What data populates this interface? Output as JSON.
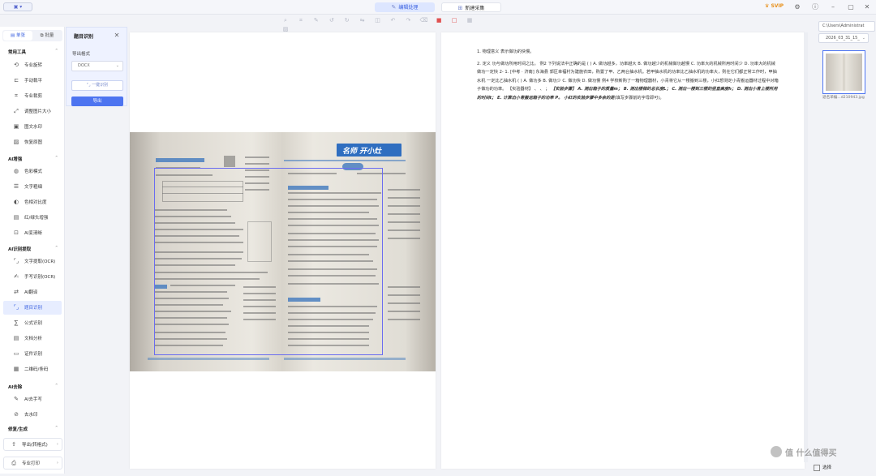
{
  "app": {
    "menu_icon": "app-menu-icon",
    "tabs": [
      {
        "label": "编辑处理",
        "icon": "edit-icon"
      },
      {
        "label": "新建采集",
        "icon": "capture-icon"
      }
    ],
    "svip": "SVIP",
    "window_icons": [
      "settings-icon",
      "help-icon",
      "minimize-icon",
      "maximize-icon",
      "close-icon"
    ]
  },
  "toolbar": {
    "tools": [
      "search-icon",
      "crop-icon",
      "pen-icon",
      "rotate-left-icon",
      "rotate-right-icon",
      "flip-icon",
      "compare-icon",
      "undo-icon",
      "redo-icon",
      "delete-icon",
      "rect-red-icon",
      "rect-outline-red-icon",
      "grid-icon",
      "image-icon"
    ]
  },
  "sidebar": {
    "tabs": [
      "单张",
      "批量"
    ],
    "sections": [
      {
        "title": "常用工具",
        "items": [
          "专业旋转",
          "手动裁平",
          "专业裁剪",
          "调整图片大小",
          "图文水印",
          "恢复原图"
        ]
      },
      {
        "title": "AI增强",
        "items": [
          "色彩模式",
          "文字粗细",
          "色相对比度",
          "红/绿头增强",
          "AI变清晰"
        ]
      },
      {
        "title": "AI识别提取",
        "items": [
          "文字提取(OCR)",
          "手写识别(OCR)",
          "AI翻译",
          "题目识别",
          "公式识别",
          "文档分析",
          "证件识别",
          "二维码/条码"
        ]
      },
      {
        "title": "AI去除",
        "items": [
          "AI去手写",
          "去水印"
        ]
      },
      {
        "title": "修复/生成",
        "items": []
      }
    ],
    "footer": [
      {
        "label": "导出(转格式)"
      },
      {
        "label": "专业打印"
      }
    ],
    "active_item": "题目识别"
  },
  "panel": {
    "title": "题目识别",
    "export_label": "导出格式",
    "format_value": "DOCX",
    "onekey_label": "一键识别",
    "export_button": "导出"
  },
  "photo": {
    "brand_text": "名师 开小灶"
  },
  "ocr": {
    "p1": "1. 物理意义 表示做功的快慢。",
    "p2a": "2. 定义 功与做功所用时间之比。 例2 下列说法中正确的是 ( ) A. 做功越多，功率越大 B. 做功越少的机械做功越慢 C. 功率大的机械所用时间少 D. 功率大的机械做功一定快 2- 1. [中考 · 济南] 东海县 郭区幸福村为建施农田，购置了甲、乙两台抽水机。若甲抽水机的功率比乙抽水机的功率大，则在它们都正常工作时，甲抽水机 一定比乙抽水机 ( ) A. 做功多 B. 做功少 C. 做功快 D. 做功慢 例4 学校新购了一箱物理器材，小青将它从一楼搬到三楼，小红想测定小青搬运器材过程中对箱子做功的功率。 【实验器材】 、 、 ；",
    "p2b": "【实验步骤】 A. 测出箱子的质量m； B. 测出楼梯的总长度L； C. 测出一楼到三楼的竖直高度h； D. 测出小青上楼所用的时间t； E. 计算出小青搬运箱子的功率 P。 小红的实验步骤中多余的是",
    "p2c": "(填写步骤前的字母即可)。"
  },
  "right": {
    "path": "C:\\Users\\Administrat",
    "date": "2026_03_31_15_",
    "thumb_name": "退名单编...d210943.jpg"
  },
  "bottom": {
    "select_label": "选择"
  },
  "watermark": "值 什么值得买"
}
